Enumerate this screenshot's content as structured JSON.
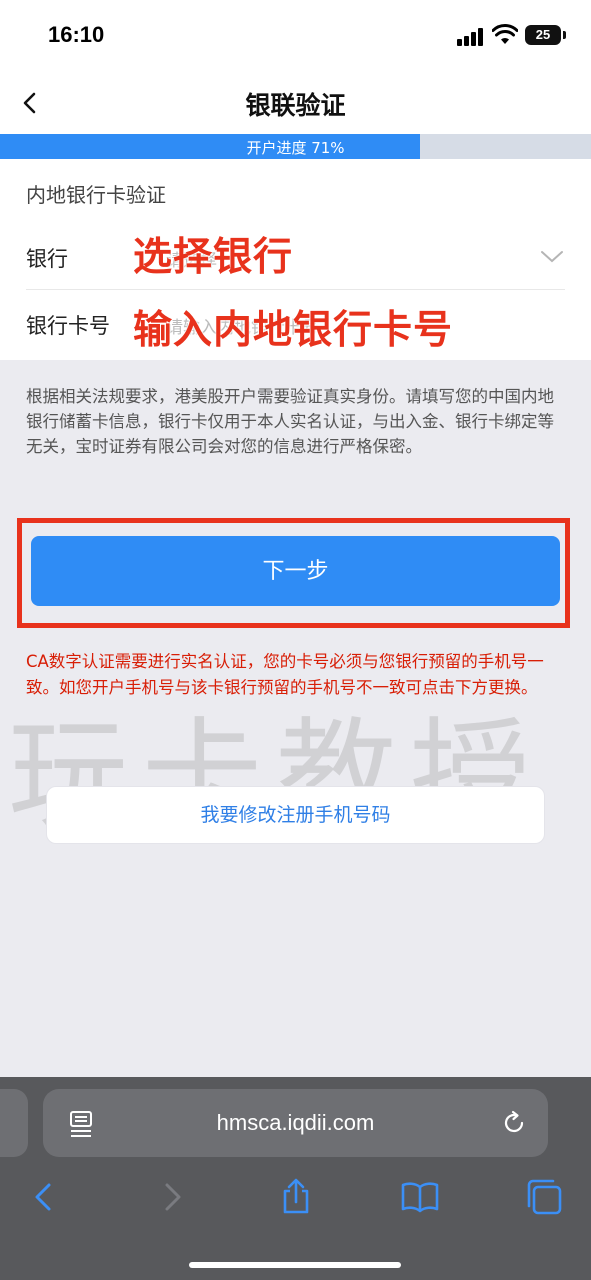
{
  "status_bar": {
    "time": "16:10",
    "battery": "25"
  },
  "nav": {
    "title": "银联验证"
  },
  "progress": {
    "label": "开户进度 71%",
    "value": 0.71
  },
  "form": {
    "section_title": "内地银行卡验证",
    "bank": {
      "label": "银行",
      "placeholder": "请选择"
    },
    "card": {
      "label": "银行卡号",
      "placeholder": "请输入内地银行卡号"
    }
  },
  "overlays": {
    "select_bank": "选择银行",
    "input_card": "输入内地银行卡号"
  },
  "notice": "根据相关法规要求，港美股开户需要验证真实身份。请填写您的中国内地银行储蓄卡信息，银行卡仅用于本人实名认证，与出入金、银行卡绑定等无关，宝时证券有限公司会对您的信息进行严格保密。",
  "next_button": "下一步",
  "warning": "CA数字认证需要进行实名认证，您的卡号必须与您银行预留的手机号一致。如您开户手机号与该卡银行预留的手机号不一致可点击下方更换。",
  "watermark": "玩卡教授",
  "modify_phone_button": "我要修改注册手机号码",
  "browser": {
    "url": "hmsca.iqdii.com"
  },
  "colors": {
    "primary": "#2f8cf5",
    "annotation_red": "#e8321c",
    "warning_red": "#d81e06"
  }
}
